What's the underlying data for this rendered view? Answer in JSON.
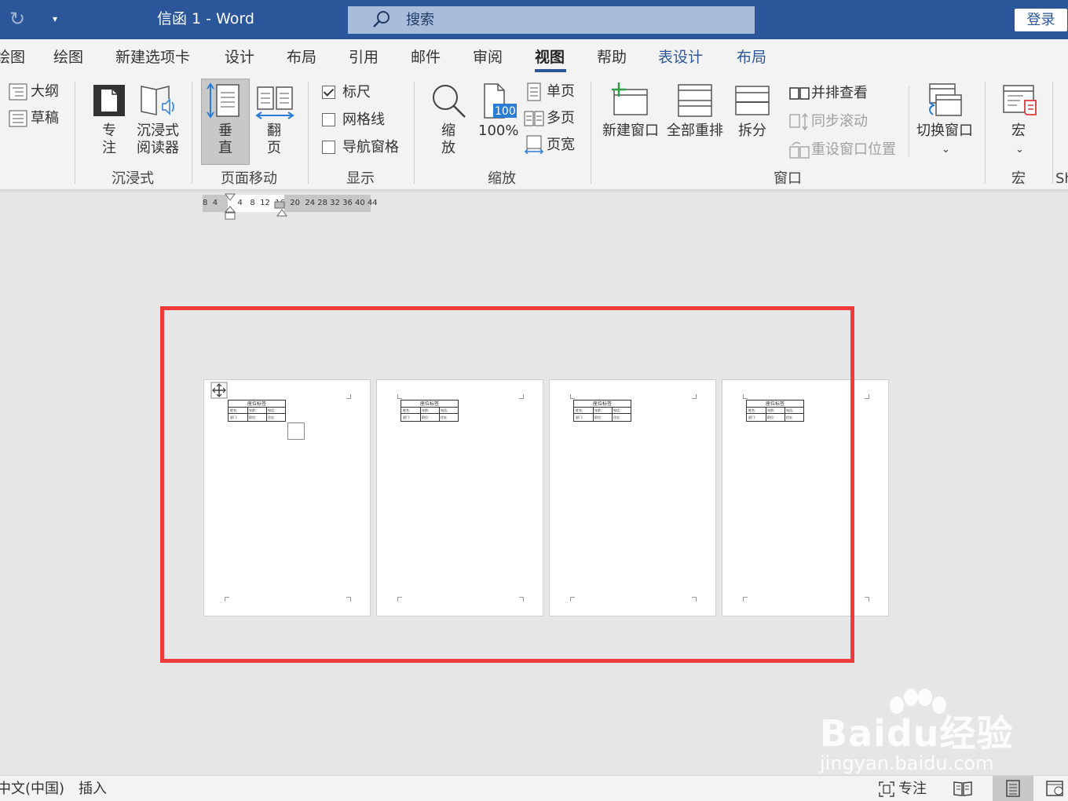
{
  "titlebar": {
    "doc_title": "信函 1  -  Word",
    "search_placeholder": "搜索",
    "login_label": "登录"
  },
  "tabs": [
    "绘图",
    "绘图",
    "新建选项卡",
    "设计",
    "布局",
    "引用",
    "邮件",
    "审阅",
    "视图",
    "帮助",
    "表设计",
    "布局"
  ],
  "active_tab": "视图",
  "ribbon": {
    "views": {
      "outline": "大纲",
      "draft": "草稿"
    },
    "immersive": {
      "focus": "专\n注",
      "reader": "沉浸式\n阅读器",
      "label": "沉浸式"
    },
    "page_move": {
      "vertical": "垂\n直",
      "side": "翻\n页",
      "label": "页面移动"
    },
    "show": {
      "ruler": "标尺",
      "ruler_checked": true,
      "gridlines": "网格线",
      "gridlines_checked": false,
      "nav_pane": "导航窗格",
      "nav_pane_checked": false,
      "label": "显示"
    },
    "zoom": {
      "zoom": "缩\n放",
      "pct_icon_text": "100",
      "pct": "100%",
      "one_page": "单页",
      "multi_page": "多页",
      "page_width": "页宽",
      "label": "缩放"
    },
    "window": {
      "new_window": "新建窗口",
      "arrange_all": "全部重排",
      "split": "拆分",
      "side_by_side": "并排查看",
      "sync_scroll": "同步滚动",
      "reset_position": "重设窗口位置",
      "switch_windows": "切换窗口",
      "label": "窗口"
    },
    "macros": {
      "macros": "宏",
      "label": "宏"
    },
    "sh_partial": "Sh"
  },
  "ruler": {
    "ticks": "8  4        4   8  12  16  20  24 28 32 36 40 44"
  },
  "pages": [
    {
      "table_caption": "座位标签",
      "row1": [
        "姓名:",
        "年龄:",
        "电话:"
      ],
      "row2": [
        "部门:",
        "职位:",
        "住址:"
      ]
    },
    {
      "table_caption": "座位标签",
      "row1": [
        "姓名:",
        "年龄:",
        "电话:"
      ],
      "row2": [
        "部门:",
        "职位:",
        "住址:"
      ]
    },
    {
      "table_caption": "座位标签",
      "row1": [
        "姓名:",
        "年龄:",
        "电话:"
      ],
      "row2": [
        "部门:",
        "职位:",
        "住址:"
      ]
    },
    {
      "table_caption": "座位标签",
      "row1": [
        "姓名:",
        "年龄:",
        "电话:"
      ],
      "row2": [
        "部门:",
        "职位:",
        "住址:"
      ]
    }
  ],
  "statusbar": {
    "language": "中文(中国)",
    "insert_mode": "插入",
    "focus": "专注"
  },
  "watermark": {
    "brand": "Baidu经验",
    "url": "jingyan.baidu.com"
  },
  "colors": {
    "title_blue": "#2b579a",
    "highlight_red": "#ef3b3b",
    "ribbon_bg": "#f3f3f3",
    "canvas_bg": "#e6e6e6"
  }
}
